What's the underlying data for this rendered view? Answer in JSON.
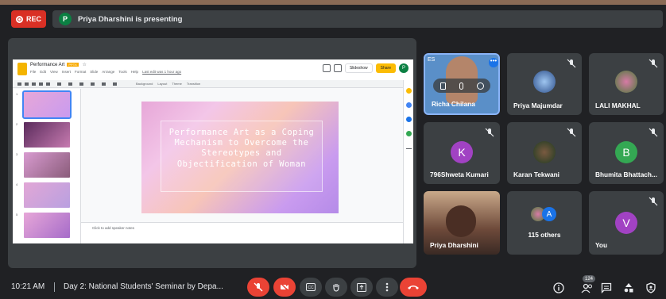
{
  "rec": {
    "label": "REC"
  },
  "presenter": {
    "initial": "P",
    "text": "Priya Dharshini is presenting"
  },
  "slides": {
    "doc_title": "Performance Art",
    "doc_badge": "PPTX",
    "menu": [
      "File",
      "Edit",
      "View",
      "Insert",
      "Format",
      "Slide",
      "Arrange",
      "Tools",
      "Help",
      "Last edit was 1 hour ago"
    ],
    "toolbar": [
      "Background",
      "Layout",
      "Theme",
      "Transition"
    ],
    "slideshow_label": "Slideshow",
    "share_label": "Share",
    "user_initial": "P",
    "slide_numbers": [
      "1",
      "2",
      "3",
      "4",
      "5"
    ],
    "slide_text": "Performance Art as a Coping Mechanism to Overcome the Stereotypes and Objectification of Woman",
    "notes_placeholder": "Click to add speaker notes"
  },
  "participants": [
    {
      "name": "Richa Chilana",
      "top_label": "ES"
    },
    {
      "name": "Priya Majumdar"
    },
    {
      "name": "LALI MAKHAL"
    },
    {
      "name": "796Shweta Kumari",
      "initial": "K",
      "color": "#a142c3"
    },
    {
      "name": "Karan Tekwani"
    },
    {
      "name": "Bhumita Bhattach...",
      "initial": "B",
      "color": "#34a853"
    },
    {
      "name": "Priya Dharshini"
    },
    {
      "name": "115 others",
      "initial": "A",
      "color": "#1a73e8"
    },
    {
      "name": "You",
      "initial": "V",
      "color": "#a142c3"
    }
  ],
  "bottom": {
    "time": "10:21 AM",
    "meeting": "Day 2: National Students' Seminar by Depa...",
    "people_count": "124"
  },
  "colors": {
    "end_call": "#ea4335",
    "muted": "#ea4335",
    "panel": "#3c4043",
    "bg": "#202124"
  }
}
